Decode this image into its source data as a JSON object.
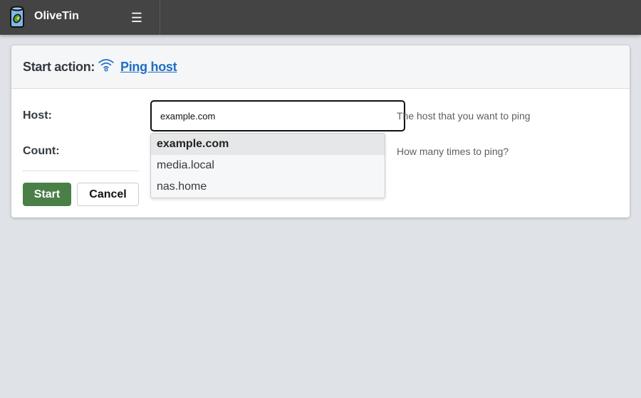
{
  "app": {
    "title": "OliveTin",
    "menu_icon": "hamburger-menu-icon",
    "logo_icon": "olive-jar-logo",
    "colors": {
      "topbar": "#444444",
      "background": "#dfe3e7",
      "accent_link": "#1e6fc4",
      "start_button": "#4a7f47"
    }
  },
  "dialog": {
    "header_label": "Start action:",
    "action_icon": "wifi-icon",
    "action_name": "Ping host",
    "fields": [
      {
        "label": "Host:",
        "value": "example.com",
        "description": "The host that you want to ping",
        "suggestions": [
          {
            "label": "example.com",
            "highlighted": true
          },
          {
            "label": "media.local",
            "highlighted": false
          },
          {
            "label": "nas.home",
            "highlighted": false
          }
        ]
      },
      {
        "label": "Count:",
        "description": "How many times to ping?"
      }
    ],
    "buttons": {
      "start": "Start",
      "cancel": "Cancel"
    }
  }
}
